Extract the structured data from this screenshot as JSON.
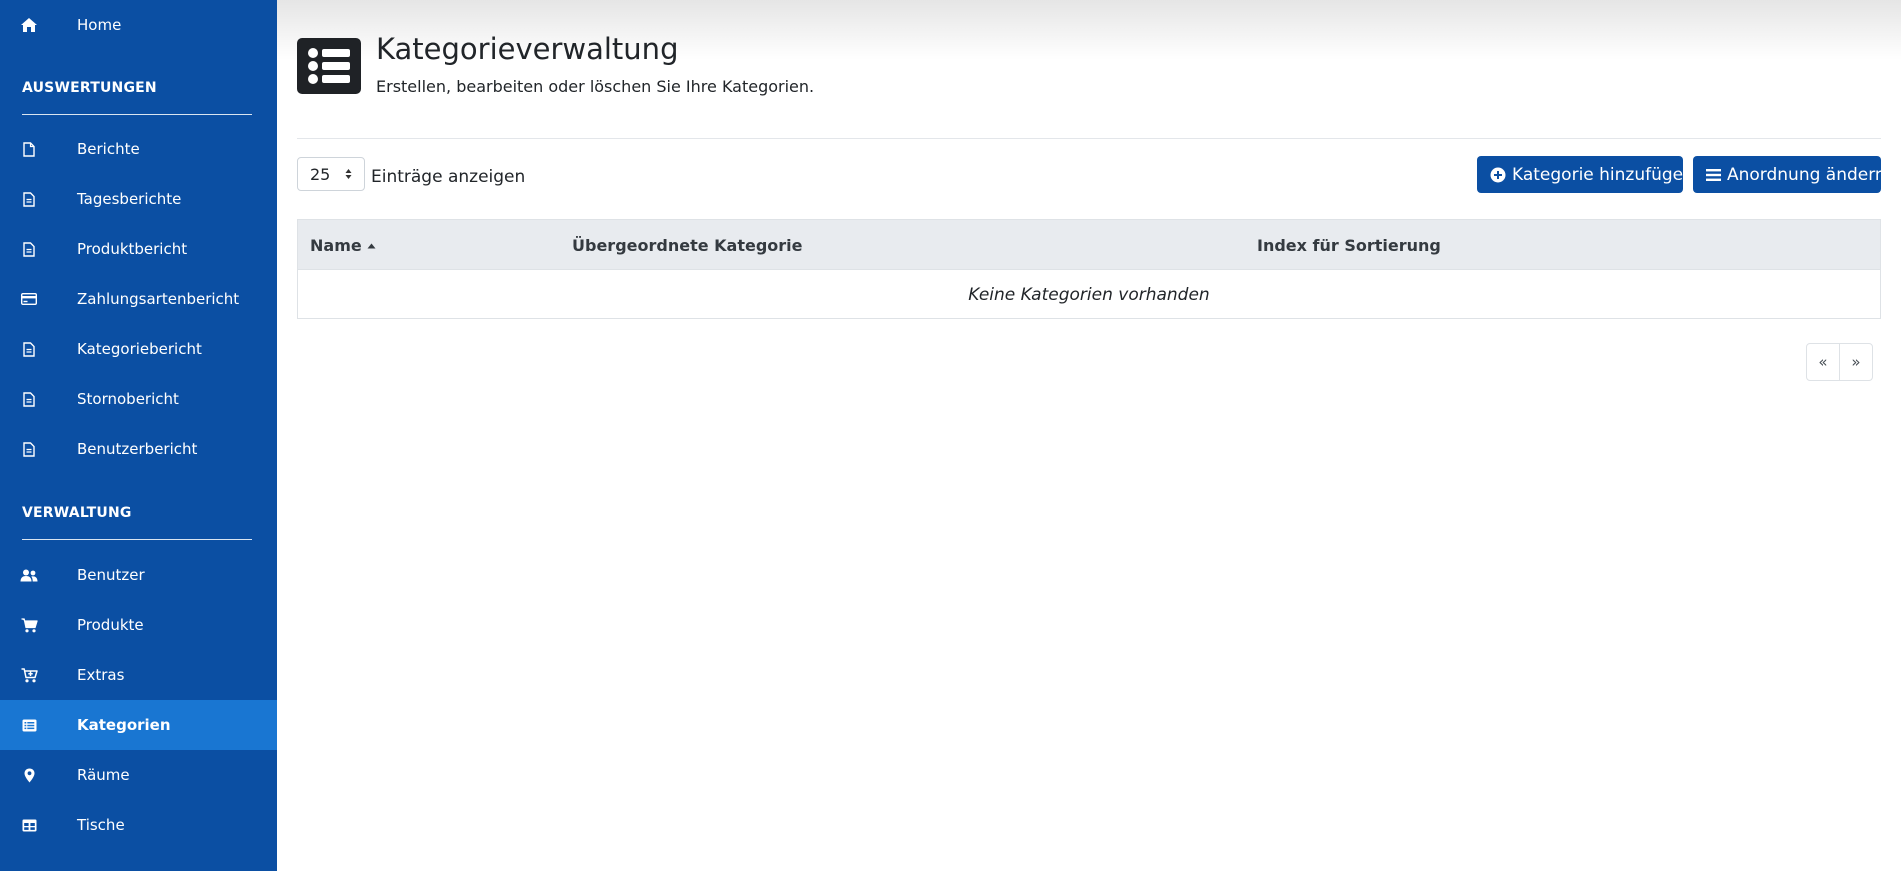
{
  "sidebar": {
    "home": "Home",
    "section_reports": "AUSWERTUNGEN",
    "reports": [
      {
        "label": "Berichte",
        "icon": "file-icon"
      },
      {
        "label": "Tagesberichte",
        "icon": "file-text-icon"
      },
      {
        "label": "Produktbericht",
        "icon": "file-text-icon"
      },
      {
        "label": "Zahlungsartenbericht",
        "icon": "credit-card-icon"
      },
      {
        "label": "Kategoriebericht",
        "icon": "file-text-icon"
      },
      {
        "label": "Stornobericht",
        "icon": "file-text-icon"
      },
      {
        "label": "Benutzerbericht",
        "icon": "file-text-icon"
      }
    ],
    "section_admin": "VERWALTUNG",
    "admin": [
      {
        "label": "Benutzer",
        "icon": "users-icon"
      },
      {
        "label": "Produkte",
        "icon": "cart-icon"
      },
      {
        "label": "Extras",
        "icon": "cart-plus-icon"
      },
      {
        "label": "Kategorien",
        "icon": "list-icon",
        "active": true
      },
      {
        "label": "Räume",
        "icon": "map-pin-icon"
      },
      {
        "label": "Tische",
        "icon": "table-icon"
      }
    ]
  },
  "header": {
    "title": "Kategorieverwaltung",
    "subtitle": "Erstellen, bearbeiten oder löschen Sie Ihre Kategorien."
  },
  "controls": {
    "page_size": "25",
    "entries_label": "Einträge anzeigen",
    "add_button": "Kategorie hinzufügen",
    "order_button": "Anordnung ändern"
  },
  "table": {
    "columns": [
      "Name",
      "Übergeordnete Kategorie",
      "Index für Sortierung"
    ],
    "sort_column": "Name",
    "sort_direction": "ascending",
    "empty_message": "Keine Kategorien vorhanden"
  },
  "pagination": {
    "prev": "«",
    "next": "»"
  },
  "colors": {
    "sidebar": "#0b4fa3",
    "active_item": "#1976d2",
    "primary_button": "#0b4fa3"
  }
}
